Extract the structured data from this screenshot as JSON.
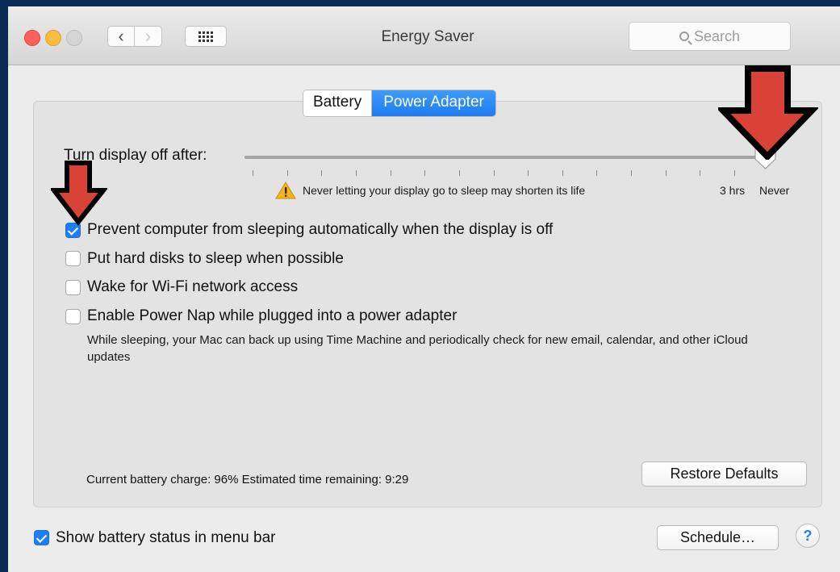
{
  "window": {
    "title": "Energy Saver"
  },
  "toolbar": {
    "search_placeholder": "Search"
  },
  "tabs": [
    {
      "label": "Battery",
      "selected": false
    },
    {
      "label": "Power Adapter",
      "selected": true
    }
  ],
  "display_sleep": {
    "label": "Turn display off after:",
    "value": "Never",
    "warning": "Never letting your display go to sleep may shorten its life",
    "tick_labels": [
      "3 hrs",
      "Never"
    ]
  },
  "options": [
    {
      "label": "Prevent computer from sleeping automatically when the display is off",
      "checked": true
    },
    {
      "label": "Put hard disks to sleep when possible",
      "checked": false
    },
    {
      "label": "Wake for Wi-Fi network access",
      "checked": false
    },
    {
      "label": "Enable Power Nap while plugged into a power adapter",
      "checked": false,
      "description": "While sleeping, your Mac can back up using Time Machine and periodically check for new email, calendar, and other iCloud updates"
    }
  ],
  "status": {
    "text": "Current battery charge: 96%  Estimated time remaining: 9:29"
  },
  "buttons": {
    "restore": "Restore Defaults",
    "schedule": "Schedule…",
    "help": "?"
  },
  "menu_bar_option": {
    "label": "Show battery status in menu bar",
    "checked": true
  },
  "colors": {
    "accent": "#1d7ef5",
    "annotation_arrow": "#d94237"
  }
}
